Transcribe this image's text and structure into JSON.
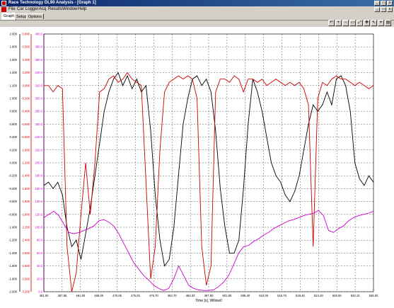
{
  "window": {
    "title": "Race Technology DL90 Analysis - [Graph 1]",
    "minimize_label": "_",
    "maximize_label": "□",
    "close_label": "x"
  },
  "menu": [
    "File",
    "Car",
    "Logger",
    "Acq",
    "Results",
    "Window",
    "Help"
  ],
  "tabs": [
    {
      "label": "Graph",
      "active": true
    },
    {
      "label": "Setup",
      "active": false
    },
    {
      "label": "Options",
      "active": false
    }
  ],
  "toolbar_icons": [
    "undo-icon",
    "zoom-in-icon",
    "zoom-out-icon",
    "zoom-box-icon",
    "fit-icon",
    "pan-icon",
    "pointer-icon",
    "cursor-icon",
    "print-icon"
  ],
  "toolbar_glyphs": [
    "↶",
    "+",
    "−",
    "▭",
    "⤢",
    "✥",
    "↖",
    "⌖",
    "▤"
  ],
  "chart_data": {
    "type": "line",
    "xlabel": "Time [s], Willow0",
    "x_ticks": [
      "461.00",
      "457.85",
      "461.90",
      "466.00",
      "470.05",
      "475.25",
      "476.70",
      "484.70",
      "484.20",
      "497.80",
      "501.90",
      "505.40",
      "510.00",
      "516.70",
      "518.45",
      "524.20",
      "528.00",
      "532.10",
      "536.00"
    ],
    "y_left": {
      "color": "#000000",
      "labels": [
        "2.000",
        "1.800",
        "1.600",
        "1.400",
        "1.200",
        "1.000",
        "0.800",
        "0.600",
        "0.400",
        "0.200",
        "0.000",
        "-0.200",
        "-0.400",
        "-0.600",
        "-0.800",
        "-1.000",
        "-1.200",
        "-1.400",
        "-1.600",
        "-1.800",
        "-2.000"
      ]
    },
    "y_mid": {
      "color": "#cc0000",
      "labels": [
        "0.800",
        "0.600",
        "0.400",
        "0.200",
        "0.000",
        "-0.200",
        "-0.400",
        "-0.600",
        "-0.800",
        "-1.000",
        "-1.200",
        "-1.400",
        "-1.600",
        "-1.800",
        "-2.000",
        "-2.200",
        "-2.400",
        "-2.600",
        "-2.800",
        "-3.000",
        "-3.200"
      ]
    },
    "y_right": {
      "color": "#cc00cc",
      "labels": [
        "400.0",
        "380.0",
        "360.0",
        "340.0",
        "320.0",
        "300.0",
        "280.0",
        "260.0",
        "240.0",
        "220.0",
        "200.0",
        "180.0",
        "160.0",
        "140.0",
        "120.0",
        "100.0",
        "80.0",
        "60.0",
        "40.0",
        "20.0",
        "0.0"
      ]
    },
    "series": [
      {
        "color": "#000000",
        "values": [
          -0.35,
          -0.3,
          -0.4,
          -0.3,
          -0.5,
          -1.0,
          -1.3,
          -1.2,
          -1.5,
          -1.1,
          -0.7,
          -0.2,
          0.3,
          0.8,
          1.1,
          1.3,
          1.4,
          1.2,
          1.35,
          1.15,
          1.3,
          1.1,
          1.2,
          0.5,
          -0.5,
          -1.2,
          -1.6,
          -1.5,
          -1.0,
          -0.2,
          0.6,
          1.0,
          1.3,
          1.35,
          1.2,
          1.3,
          1.1,
          0.5,
          -0.4,
          -1.0,
          -1.4,
          -1.4,
          -1.2,
          -0.4,
          0.6,
          1.3,
          1.1,
          0.8,
          0.4,
          0.0,
          -0.2,
          -0.3,
          -0.5,
          -0.6,
          -0.45,
          -0.2,
          0.2,
          0.6,
          0.9,
          0.8,
          0.9,
          1.1,
          0.9,
          1.3,
          1.35,
          1.2,
          0.8,
          0.0,
          -0.25,
          -0.35,
          -0.2,
          -0.3
        ]
      },
      {
        "color": "#cc0000",
        "values": [
          0.0,
          0.0,
          -0.1,
          0.0,
          -0.05,
          -2.5,
          -3.2,
          -2.9,
          -2.0,
          -1.2,
          -2.0,
          -1.2,
          -0.1,
          -0.05,
          0.1,
          0.15,
          0.05,
          0.1,
          0.2,
          0.1,
          0.05,
          0.0,
          -1.5,
          -3.0,
          -2.5,
          -1.0,
          -0.1,
          0.05,
          0.1,
          0.15,
          0.1,
          0.15,
          0.1,
          -0.2,
          -2.5,
          -3.1,
          -2.8,
          -0.1,
          0.1,
          0.1,
          0.05,
          0.15,
          0.1,
          -0.1,
          0.1,
          0.1,
          0.05,
          0.1,
          0.0,
          0.05,
          0.1,
          0.05,
          0.0,
          0.05,
          0.0,
          0.05,
          -0.05,
          -0.3,
          -2.5,
          -0.2,
          0.05,
          0.0,
          0.1,
          0.15,
          0.1,
          0.1,
          0.05,
          0.0,
          0.05,
          0.0,
          -0.05,
          0.0
        ]
      },
      {
        "color": "#cc00cc",
        "values": [
          115,
          120,
          125,
          118,
          105,
          92,
          90,
          92,
          95,
          98,
          102,
          110,
          112,
          108,
          102,
          90,
          75,
          60,
          45,
          35,
          25,
          18,
          10,
          5,
          2,
          5,
          20,
          40,
          25,
          10,
          5,
          3,
          2,
          2,
          3,
          8,
          15,
          25,
          42,
          60,
          70,
          72,
          78,
          82,
          88,
          92,
          98,
          102,
          106,
          110,
          112,
          115,
          118,
          120,
          122,
          126,
          118,
          95,
          92,
          98,
          102,
          110,
          115,
          118,
          120,
          122,
          125
        ]
      }
    ]
  }
}
